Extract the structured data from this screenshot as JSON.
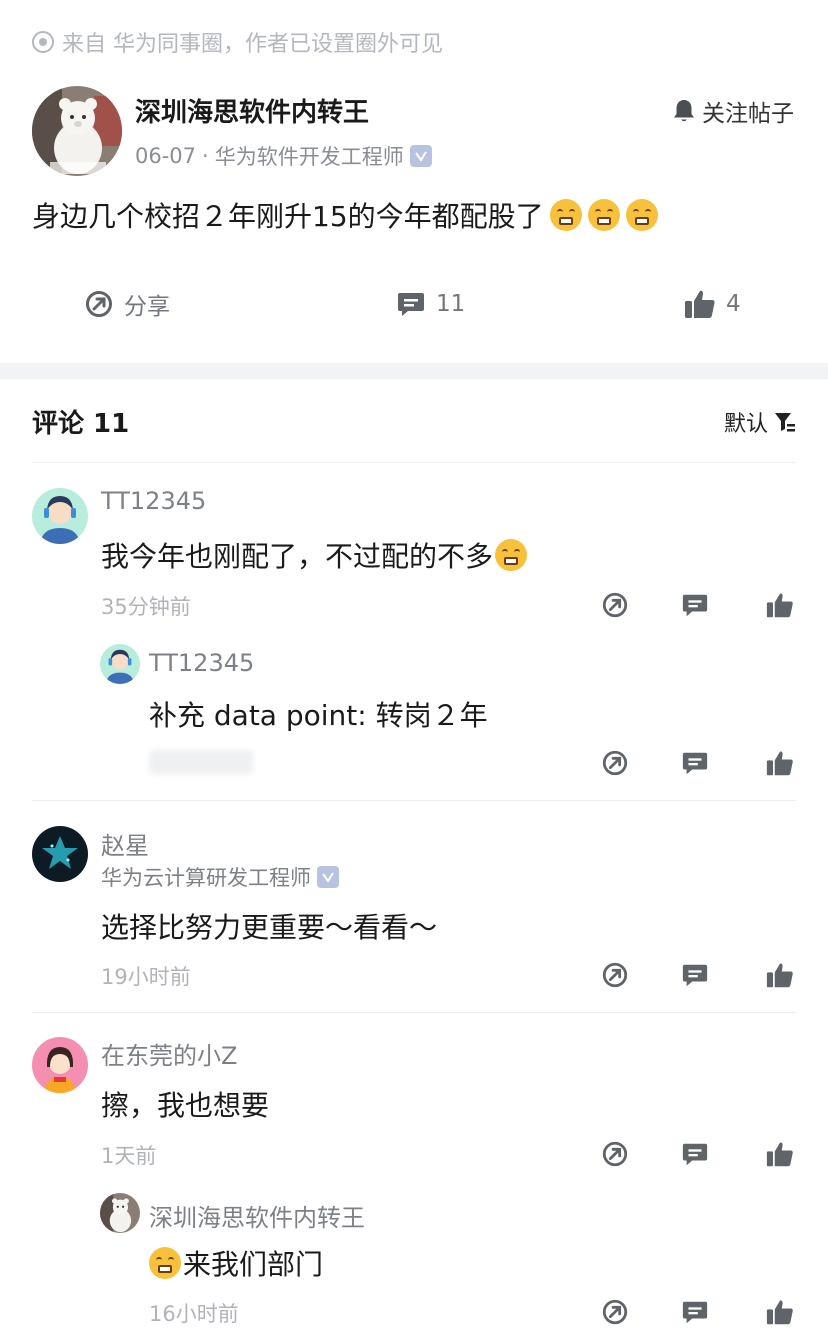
{
  "source": {
    "text": "来自 华为同事圈，作者已设置圈外可见"
  },
  "post": {
    "author_name": "深圳海思软件内转王",
    "date": "06-07",
    "separator": "·",
    "author_title": "华为软件开发工程师",
    "follow_label": "关注帖子",
    "content": "身边几个校招２年刚升15的今年都配股了",
    "share_label": "分享",
    "comment_count": "11",
    "like_count": "4"
  },
  "comments_header": {
    "title": "评论 11",
    "sort_label": "默认"
  },
  "comments": [
    {
      "name": "TT12345",
      "text": "我今年也刚配了，不过配的不多",
      "time": "35分钟前",
      "reply": {
        "name": "TT12345",
        "text": "补充 data point: 转岗２年"
      }
    },
    {
      "name": "赵星",
      "title": "华为云计算研发工程师",
      "text": "选择比努力更重要～看看～",
      "time": "19小时前"
    },
    {
      "name": "在东莞的小Z",
      "text": "擦，我也想要",
      "time": "1天前",
      "reply": {
        "name": "深圳海思软件内转王",
        "text": "来我们部门",
        "time": "16小时前"
      }
    }
  ],
  "colors": {
    "muted": "#b4b7bd",
    "icon": "#5f636a",
    "band": "#f2f3f5",
    "verify": "#b7c3e0"
  },
  "icons": [
    "share-icon",
    "comment-icon",
    "like-icon",
    "bell-icon",
    "filter-icon"
  ]
}
